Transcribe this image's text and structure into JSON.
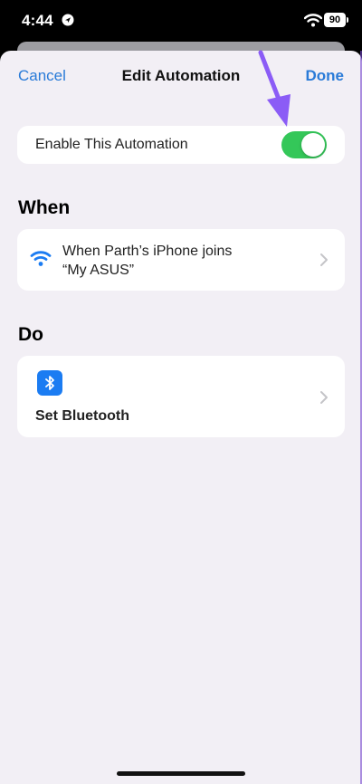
{
  "status_bar": {
    "time": "4:44",
    "battery": "90"
  },
  "nav": {
    "cancel": "Cancel",
    "title": "Edit Automation",
    "done": "Done"
  },
  "enable": {
    "label": "Enable This Automation",
    "state": "on"
  },
  "when": {
    "header": "When",
    "line1": "When Parth’s iPhone joins",
    "line2": "“My ASUS”"
  },
  "do": {
    "header": "Do",
    "action": "Set Bluetooth"
  },
  "colors": {
    "accent": "#2a7bd8",
    "toggle_on": "#34c759",
    "bluetooth_tile": "#1b7cf2",
    "annotation_arrow": "#8b5cf6"
  },
  "icons": [
    "location-icon",
    "wifi-status-icon",
    "battery-icon",
    "wifi-icon",
    "bluetooth-icon",
    "chevron-right-icon",
    "annotation-arrow"
  ]
}
